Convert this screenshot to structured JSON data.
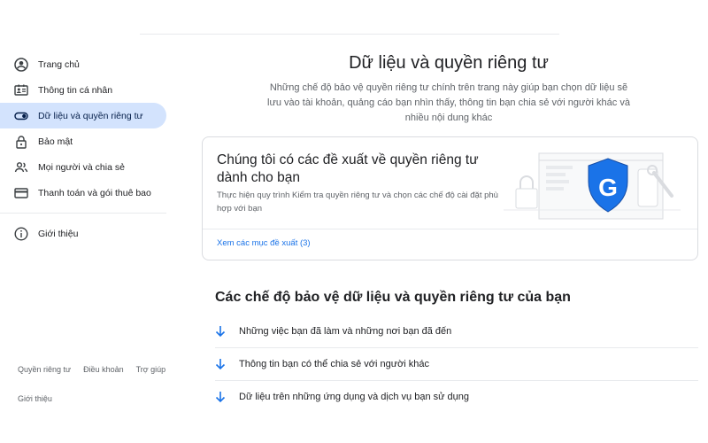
{
  "sidebar": {
    "items": [
      {
        "label": "Trang chủ",
        "icon": "account-circle-icon"
      },
      {
        "label": "Thông tin cá nhân",
        "icon": "id-card-icon"
      },
      {
        "label": "Dữ liệu và quyền riêng tư",
        "icon": "toggle-icon",
        "active": true
      },
      {
        "label": "Bảo mật",
        "icon": "lock-icon"
      },
      {
        "label": "Mọi người và chia sẻ",
        "icon": "people-icon"
      },
      {
        "label": "Thanh toán và gói thuê bao",
        "icon": "credit-card-icon"
      }
    ],
    "about": {
      "label": "Giới thiệu",
      "icon": "info-icon"
    }
  },
  "footer": {
    "privacy": "Quyền riêng tư",
    "terms": "Điều khoản",
    "help": "Trợ giúp",
    "about": "Giới thiệu"
  },
  "main": {
    "title": "Dữ liệu và quyền riêng tư",
    "description": "Những chế độ bảo vệ quyền riêng tư chính trên trang này giúp bạn chọn dữ liệu sẽ lưu vào tài khoản, quảng cáo bạn nhìn thấy, thông tin bạn chia sẻ với người khác và nhiều nội dung khác",
    "card": {
      "title": "Chúng tôi có các đề xuất về quyền riêng tư dành cho bạn",
      "description": "Thực hiện quy trình Kiểm tra quyền riêng tư và chọn các chế độ cài đặt phù hợp với bạn",
      "link": "Xem các mục đề xuất (3)",
      "badge_letter": "G"
    },
    "section_title": "Các chế độ bảo vệ dữ liệu và quyền riêng tư của bạn",
    "rows": [
      {
        "label": "Những việc bạn đã làm và những nơi bạn đã đến"
      },
      {
        "label": "Thông tin bạn có thể chia sẻ với người khác"
      },
      {
        "label": "Dữ liệu trên những ứng dụng và dịch vụ bạn sử dụng"
      }
    ]
  },
  "colors": {
    "accent": "#1a73e8",
    "active_bg": "#d3e3fd",
    "shield": "#1a73e8"
  }
}
